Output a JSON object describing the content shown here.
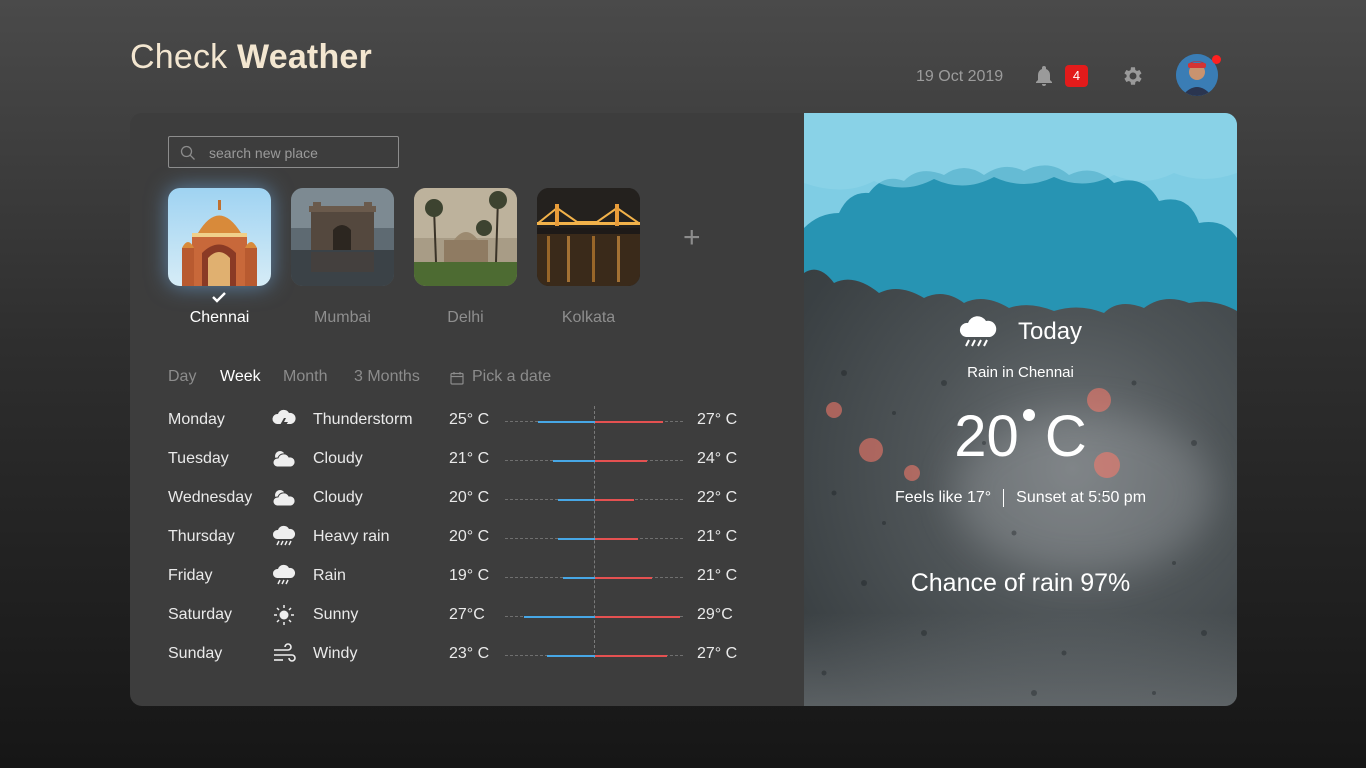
{
  "header": {
    "title_light": "Check",
    "title_bold": "Weather",
    "date": "19 Oct 2019",
    "notification_count": "4"
  },
  "search": {
    "placeholder": "search new place"
  },
  "cities": [
    {
      "name": "Chennai",
      "selected": true
    },
    {
      "name": "Mumbai",
      "selected": false
    },
    {
      "name": "Delhi",
      "selected": false
    },
    {
      "name": "Kolkata",
      "selected": false
    }
  ],
  "add_label": "+",
  "tabs": {
    "day": "Day",
    "week": "Week",
    "month": "Month",
    "three_months": "3 Months",
    "pick_date": "Pick a date",
    "active": "Week"
  },
  "forecast": [
    {
      "day": "Monday",
      "icon": "thunderstorm-icon",
      "condition": "Thunderstorm",
      "low": "25° C",
      "high": "27° C"
    },
    {
      "day": "Tuesday",
      "icon": "cloudy-icon",
      "condition": "Cloudy",
      "low": "21° C",
      "high": "24° C"
    },
    {
      "day": "Wednesday",
      "icon": "cloudy-icon",
      "condition": "Cloudy",
      "low": "20° C",
      "high": "22° C"
    },
    {
      "day": "Thursday",
      "icon": "heavy-rain-icon",
      "condition": "Heavy rain",
      "low": "20° C",
      "high": "21° C"
    },
    {
      "day": "Friday",
      "icon": "rain-icon",
      "condition": "Rain",
      "low": "19° C",
      "high": "21° C"
    },
    {
      "day": "Saturday",
      "icon": "sunny-icon",
      "condition": "Sunny",
      "low": "27°C",
      "high": "29°C"
    },
    {
      "day": "Sunday",
      "icon": "windy-icon",
      "condition": "Windy",
      "low": "23° C",
      "high": "27° C"
    }
  ],
  "today": {
    "label": "Today",
    "subtitle": "Rain in Chennai",
    "temp": "20",
    "unit": "C",
    "feels_like": "Feels like 17°",
    "sunset": "Sunset at 5:50 pm",
    "chance": "Chance of rain 97%"
  },
  "colors": {
    "accent_blue": "#47a7e6",
    "accent_red": "#e55151",
    "sky": "#7fd0e6",
    "badge": "#e31b1b"
  }
}
